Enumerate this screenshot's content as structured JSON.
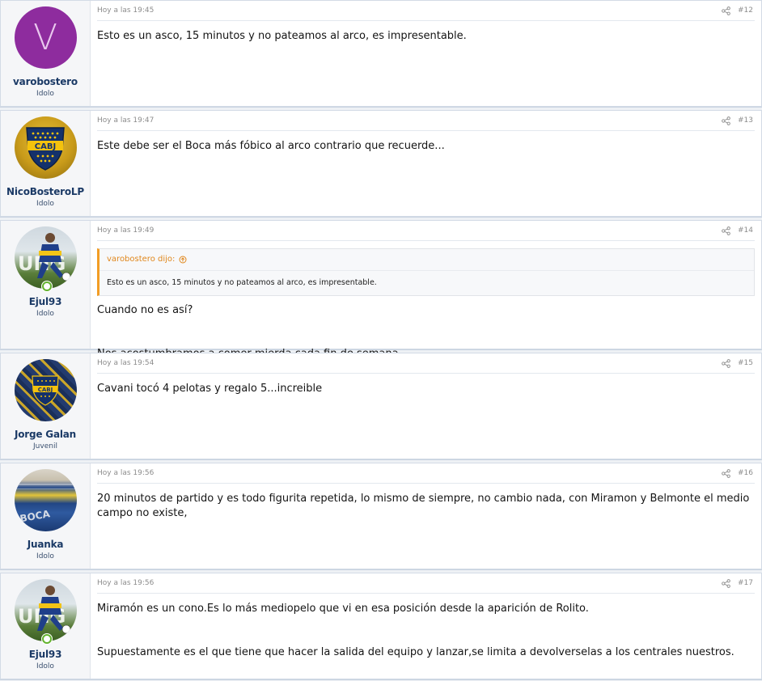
{
  "colors": {
    "page_bg": "#eef1f5",
    "username": "#1b3a66",
    "quote_accent": "#f29d25",
    "online": "#63b32e"
  },
  "posts": [
    {
      "username": "varobostero",
      "usertitle": "Idolo",
      "time": "Hoy a las 19:45",
      "number": "#12",
      "avatar": {
        "type": "letter",
        "letter": "V",
        "color": "#8e2c9e"
      },
      "online": false,
      "body": [
        "Esto es un asco, 15 minutos y no pateamos al arco, es impresentable."
      ]
    },
    {
      "username": "NicoBosteroLP",
      "usertitle": "Idolo",
      "time": "Hoy a las 19:47",
      "number": "#13",
      "avatar": {
        "type": "crest-yellow"
      },
      "online": false,
      "body": [
        "Este debe ser el Boca más fóbico al arco contrario que recuerde..."
      ]
    },
    {
      "username": "Ejul93",
      "usertitle": "Idolo",
      "time": "Hoy a las 19:49",
      "number": "#14",
      "avatar": {
        "type": "player"
      },
      "online": true,
      "quote": {
        "author": "varobostero dijo:",
        "text": "Esto es un asco, 15 minutos y no pateamos al arco, es impresentable."
      },
      "body": [
        "Cuando no es así?",
        "Nos acostumbramos a comer mierda cada fin de semana."
      ]
    },
    {
      "username": "Jorge Galan",
      "usertitle": "Juvenil",
      "time": "Hoy a las 19:54",
      "number": "#15",
      "avatar": {
        "type": "crest-pattern"
      },
      "online": false,
      "body": [
        "Cavani tocó 4 pelotas y regalo 5...increible"
      ]
    },
    {
      "username": "Juanka",
      "usertitle": "Idolo",
      "time": "Hoy a las 19:56",
      "number": "#16",
      "avatar": {
        "type": "stadium"
      },
      "online": false,
      "body": [
        "20 minutos de partido y es todo figurita repetida, lo mismo de siempre, no cambio nada, con Miramon y Belmonte el medio campo no existe,"
      ]
    },
    {
      "username": "Ejul93",
      "usertitle": "Idolo",
      "time": "Hoy a las 19:56",
      "number": "#17",
      "avatar": {
        "type": "player"
      },
      "online": true,
      "body": [
        "Miramón es un cono.Es lo más mediopelo que vi en esa posición desde la aparición de Rolito.",
        "Supuestamente es el que tiene que hacer la salida del equipo y lanzar,se limita a devolverselas a los centrales nuestros."
      ]
    }
  ]
}
